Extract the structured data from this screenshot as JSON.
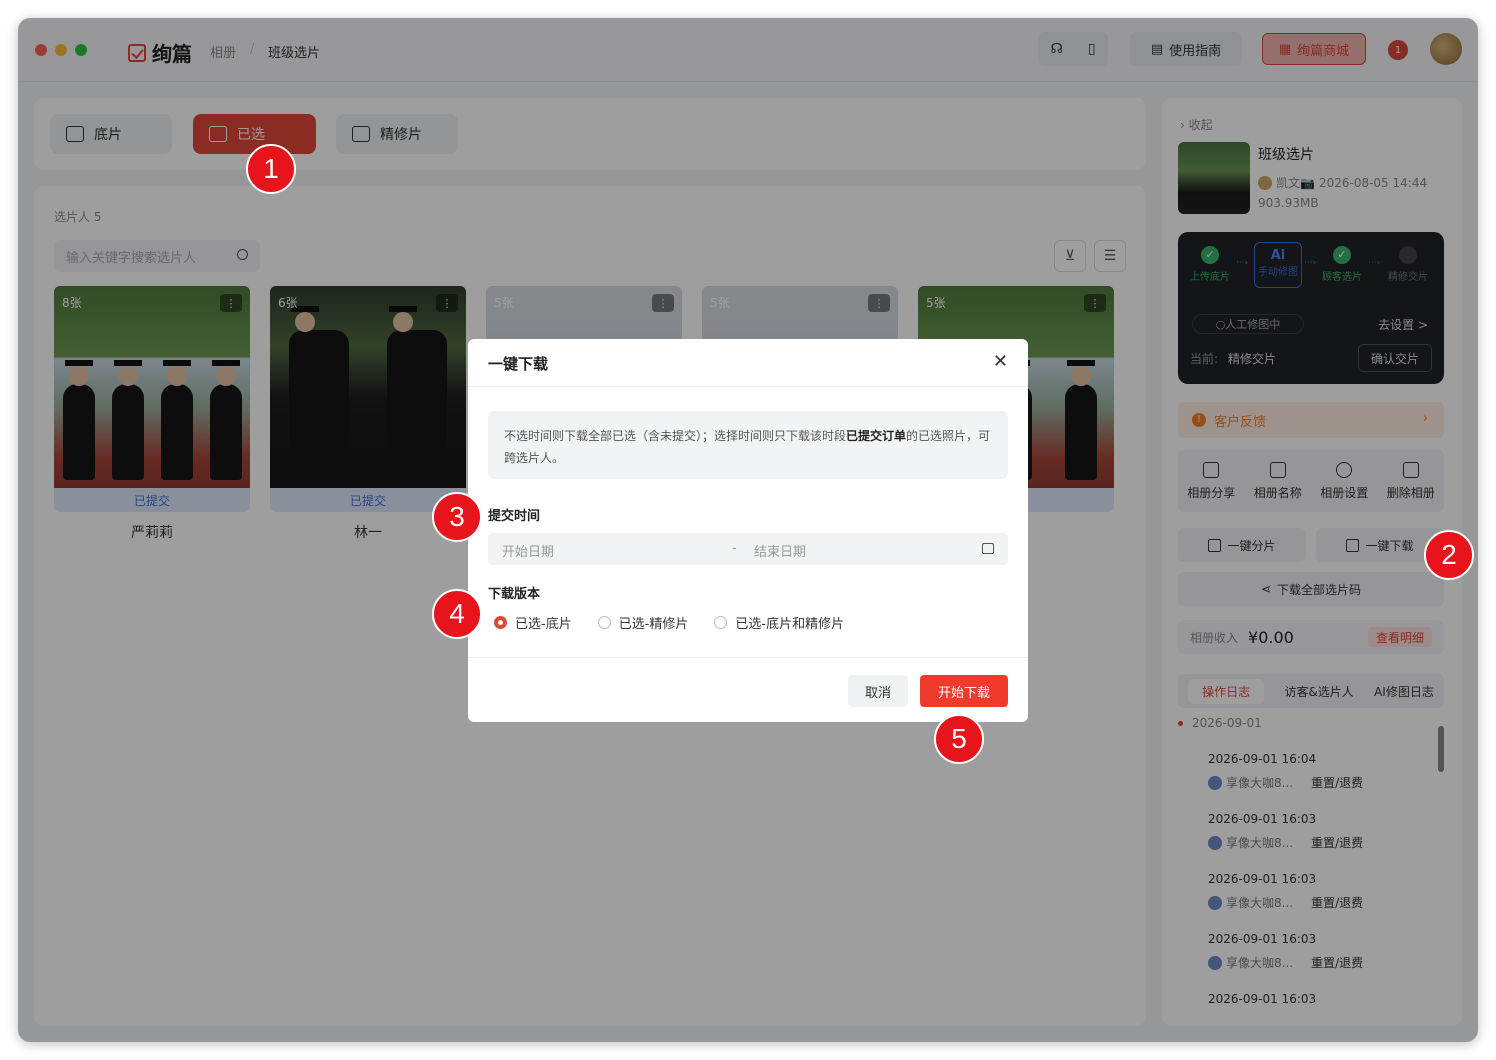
{
  "app": {
    "name": "绚篇",
    "breadcrumb": [
      "相册",
      "班级选片"
    ]
  },
  "topbar": {
    "guide_label": "使用指南",
    "shop_label": "绚篇商城",
    "notify_count": "1"
  },
  "tabs": [
    {
      "label": "底片"
    },
    {
      "label": "已选"
    },
    {
      "label": "精修片"
    }
  ],
  "grid": {
    "selector_count": "选片人 5",
    "search_placeholder": "输入关键字搜索选片人",
    "photos": [
      {
        "count": "8张",
        "status": "已提交",
        "name": "严莉莉"
      },
      {
        "count": "6张",
        "status": "已提交",
        "name": "林一"
      },
      {
        "count": "5张",
        "status": "",
        "name": ""
      },
      {
        "count": "5张",
        "status": "",
        "name": ""
      },
      {
        "count": "5张",
        "status": "交",
        "name": ""
      }
    ]
  },
  "sidebar": {
    "collapse": "收起",
    "album_title": "班级选片",
    "album_owner": "凯文📷",
    "album_date": "2026-08-05 14:44",
    "album_size": "903.93MB",
    "flow": {
      "steps": [
        "上传底片",
        "手动修图",
        "顾客选片",
        "精修交片"
      ],
      "ai_label": "Ai",
      "status": "人工修图中",
      "goto": "去设置 >",
      "current_label": "当前:",
      "current_value": "精修交片",
      "confirm": "确认交片"
    },
    "feedback": "客户反馈",
    "actions": [
      "相册分享",
      "相册名称",
      "相册设置",
      "删除相册"
    ],
    "share_btn": "一键分片",
    "download_btn": "一键下载",
    "download_codes": "下载全部选片码",
    "income_label": "相册收入",
    "income_value": "¥0.00",
    "income_detail": "查看明细",
    "log_tabs": [
      "操作日志",
      "访客&选片人",
      "AI修图日志"
    ],
    "log_date": "2026-09-01",
    "logs": [
      {
        "time": "2026-09-01 16:04",
        "user": "享像大咖8...",
        "op": "重置/退费"
      },
      {
        "time": "2026-09-01 16:03",
        "user": "享像大咖8...",
        "op": "重置/退费"
      },
      {
        "time": "2026-09-01 16:03",
        "user": "享像大咖8...",
        "op": "重置/退费"
      },
      {
        "time": "2026-09-01 16:03",
        "user": "享像大咖8...",
        "op": "重置/退费"
      },
      {
        "time": "2026-09-01 16:03",
        "user": "",
        "op": ""
      }
    ]
  },
  "modal": {
    "title": "一键下载",
    "notice_a": "不选时间则下载全部已选（含未提交）；选择时间则只下载该时段",
    "notice_b": "已提交订单",
    "notice_c": "的已选照片，可跨选片人。",
    "time_label": "提交时间",
    "start_placeholder": "开始日期",
    "dash": "-",
    "end_placeholder": "结束日期",
    "version_label": "下载版本",
    "options": [
      "已选-底片",
      "已选-精修片",
      "已选-底片和精修片"
    ],
    "selected_option": "已选-底片",
    "cancel": "取消",
    "start": "开始下载"
  },
  "markers": [
    "1",
    "2",
    "3",
    "4",
    "5"
  ]
}
